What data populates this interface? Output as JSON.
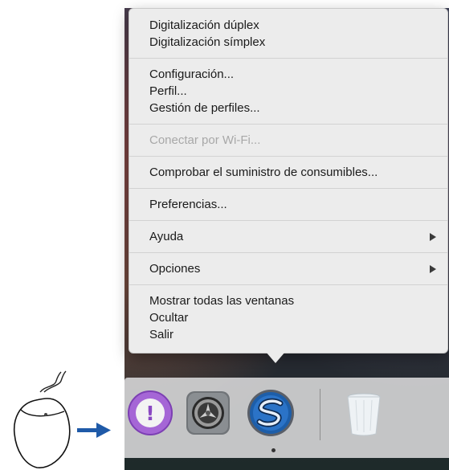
{
  "menu": {
    "groups": [
      [
        {
          "label": "Digitalización dúplex",
          "enabled": true
        },
        {
          "label": "Digitalización símplex",
          "enabled": true
        }
      ],
      [
        {
          "label": "Configuración...",
          "enabled": true
        },
        {
          "label": "Perfil...",
          "enabled": true
        },
        {
          "label": "Gestión de perfiles...",
          "enabled": true
        }
      ],
      [
        {
          "label": "Conectar por Wi-Fi...",
          "enabled": false
        }
      ],
      [
        {
          "label": "Comprobar el suministro de consumibles...",
          "enabled": true
        }
      ],
      [
        {
          "label": "Preferencias...",
          "enabled": true
        }
      ],
      [
        {
          "label": "Ayuda",
          "enabled": true,
          "submenu": true
        }
      ],
      [
        {
          "label": "Opciones",
          "enabled": true,
          "submenu": true
        }
      ],
      [
        {
          "label": "Mostrar todas las ventanas",
          "enabled": true
        },
        {
          "label": "Ocultar",
          "enabled": true
        },
        {
          "label": "Salir",
          "enabled": true
        }
      ]
    ]
  },
  "dock": {
    "apps": [
      {
        "icon": "feedback-assistant-icon",
        "glyph": "!"
      },
      {
        "icon": "system-preferences-icon"
      },
      {
        "icon": "scansnap-manager-icon",
        "running": true
      },
      {
        "icon": "trash-icon"
      }
    ]
  },
  "illustration": {
    "mouse": "mouse-icon",
    "arrow": "arrow-right-icon",
    "arrow_color": "#1f5aa8"
  }
}
